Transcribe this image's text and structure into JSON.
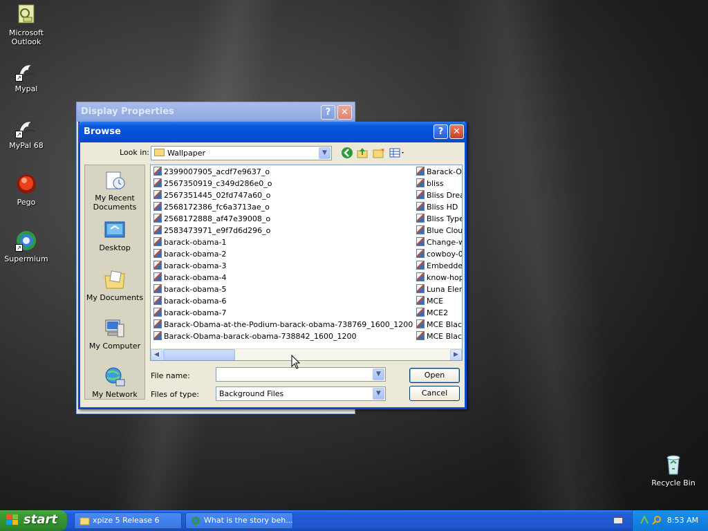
{
  "desktop": {
    "icons": [
      {
        "label": "Microsoft Outlook",
        "icon": "outlook-icon"
      },
      {
        "label": "Mypal",
        "icon": "mypal-icon"
      },
      {
        "label": "MyPal 68",
        "icon": "mypal-icon"
      },
      {
        "label": "Pego",
        "icon": "pego-icon"
      },
      {
        "label": "Supermium",
        "icon": "supermium-icon"
      },
      {
        "label": "Recycle Bin",
        "icon": "recycle-bin-icon"
      }
    ]
  },
  "display_properties": {
    "title": "Display Properties",
    "help": "?",
    "close": "✕"
  },
  "browse": {
    "title": "Browse",
    "help": "?",
    "close": "✕",
    "look_in_label": "Look in:",
    "look_in_value": "Wallpaper",
    "places": [
      {
        "label": "My Recent Documents",
        "icon": "recent-documents-icon"
      },
      {
        "label": "Desktop",
        "icon": "desktop-icon"
      },
      {
        "label": "My Documents",
        "icon": "my-documents-icon"
      },
      {
        "label": "My Computer",
        "icon": "my-computer-icon"
      },
      {
        "label": "My Network",
        "icon": "my-network-icon"
      }
    ],
    "files_col1": [
      "2399007905_acdf7e9637_o",
      "2567350919_c349d286e0_o",
      "2567351445_02fd747a60_o",
      "2568172386_fc6a3713ae_o",
      "2568172888_af47e39008_o",
      "2583473971_e9f7d6d296_o",
      "barack-obama-1",
      "barack-obama-2",
      "barack-obama-3",
      "barack-obama-4",
      "barack-obama-5",
      "barack-obama-6",
      "barack-obama-7",
      "Barack-Obama-at-the-Podium-barack-obama-738769_1600_1200",
      "Barack-Obama-barack-obama-738842_1600_1200"
    ],
    "files_col2": [
      "Barack-Ob",
      "bliss",
      "Bliss Drear",
      "Bliss HD",
      "Bliss Type",
      "Blue Clouc",
      "Change-w",
      "cowboy-0",
      "Embeddec",
      "know-hop",
      "Luna Elem",
      "MCE",
      "MCE2",
      "MCE Black",
      "MCE Black"
    ],
    "file_name_label": "File name:",
    "file_name_value": "",
    "files_of_type_label": "Files of type:",
    "files_of_type_value": "Background Files",
    "open_label": "Open",
    "cancel_label": "Cancel"
  },
  "taskbar": {
    "start_label": "start",
    "tasks": [
      {
        "label": "xpize 5 Release 6",
        "icon": "folder-icon"
      },
      {
        "label": "What is the story beh...",
        "icon": "browser-icon"
      }
    ],
    "clock": "8:53 AM"
  }
}
